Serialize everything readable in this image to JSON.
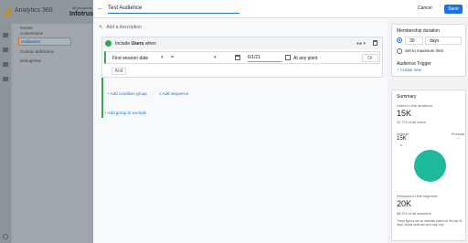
{
  "app": {
    "title": "Analytics 360",
    "breadcrumb": "All accounts > Infotrust",
    "property_name": "Infotrust"
  },
  "nav": {
    "items": [
      {
        "label": "Events"
      },
      {
        "label": "Conversions"
      },
      {
        "label": "Audiences"
      },
      {
        "label": "Custom definitions"
      },
      {
        "label": "DebugView"
      }
    ]
  },
  "panel": {
    "audience_name": "Test Audience",
    "cancel_label": "Cancel",
    "save_label": "Save",
    "add_description": "Add a description",
    "include_prefix": "Include",
    "include_subject": "Users",
    "include_suffix": "when",
    "condition": {
      "dimension": "First session date",
      "operator": "=",
      "date_value": "6/1/21",
      "any_point_label": "At any point",
      "or_label": "Or",
      "and_label": "And"
    },
    "add_condition_group": "Add condition group",
    "add_sequence": "Add sequence",
    "add_group_to_exclude": "Add group to exclude"
  },
  "membership": {
    "title": "Membership duration",
    "value": "30",
    "unit": "days",
    "max_label": "Set to maximum limit",
    "trigger_title": "Audience Trigger",
    "trigger_new": "+ Create new"
  },
  "summary": {
    "title": "Summary",
    "users_label": "Users in this audience",
    "users_value": "15K",
    "users_pct": "91.7% of all users",
    "include_label": "Include",
    "exclude_label": "Exclude",
    "include_value": "15K",
    "exclude_value": "-",
    "include_count": "N",
    "sessions_label": "Sessions in this segment",
    "sessions_value": "20K",
    "sessions_pct": "88.2% of all sessions",
    "note": "These figures are an estimate based on the last 30 days. Actual audience size may vary."
  },
  "colors": {
    "accent": "#1a73e8",
    "include_green": "#34a853",
    "venn": "#1fba9c",
    "nav_highlight": "#e8710a"
  }
}
